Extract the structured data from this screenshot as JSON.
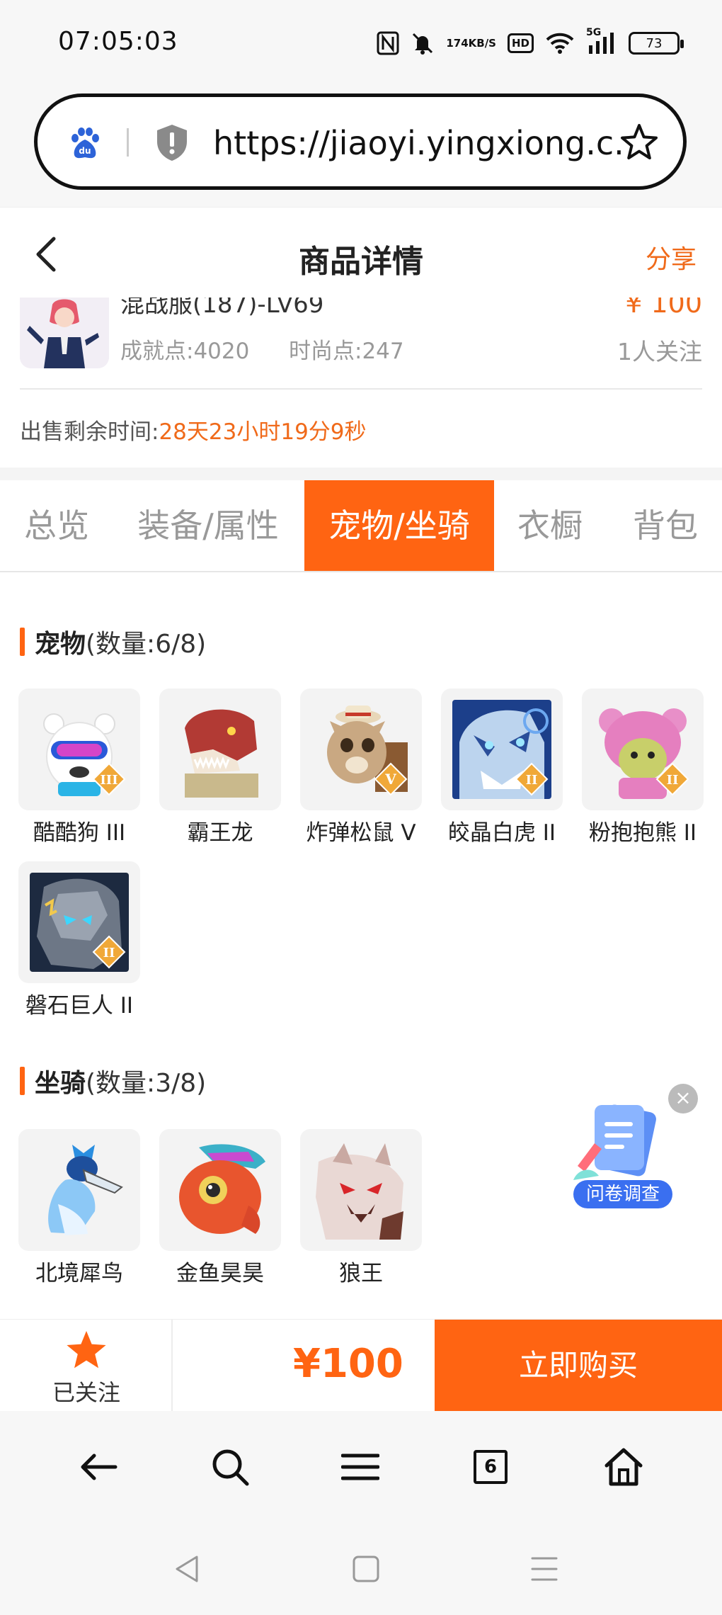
{
  "status_bar": {
    "time": "07:05:03",
    "speed_value": "174",
    "speed_unit": "KB/S",
    "hd_label": "HD",
    "network_label": "5G",
    "battery": "73"
  },
  "browser": {
    "url": "https://jiaoyi.yingxiong.c...",
    "tab_count": "6"
  },
  "header": {
    "title": "商品详情",
    "share_label": "分享"
  },
  "item": {
    "name": "混战服(187)-LV69",
    "price": "¥ 100",
    "achievement": "成就点:4020",
    "fashion": "时尚点:247",
    "followers": "1人关注",
    "remaining_label": "出售剩余时间:",
    "remaining_value": "28天23小时19分9秒"
  },
  "tabs": [
    {
      "label": "总览",
      "active": false
    },
    {
      "label": "装备/属性",
      "active": false
    },
    {
      "label": "宠物/坐骑",
      "active": true
    },
    {
      "label": "衣橱",
      "active": false
    },
    {
      "label": "背包",
      "active": false
    }
  ],
  "pets": {
    "title": "宠物",
    "count": "(数量:6/8)",
    "items": [
      {
        "label": "酷酷狗 III",
        "grade": "III"
      },
      {
        "label": "霸王龙",
        "grade": ""
      },
      {
        "label": "炸弹松鼠 V",
        "grade": "V"
      },
      {
        "label": "皎晶白虎 II",
        "grade": "II"
      },
      {
        "label": "粉抱抱熊 II",
        "grade": "II"
      },
      {
        "label": "磐石巨人 II",
        "grade": "II"
      }
    ]
  },
  "mounts": {
    "title": "坐骑",
    "count": "(数量:3/8)",
    "items": [
      {
        "label": "北境犀鸟"
      },
      {
        "label": "金鱼昊昊"
      },
      {
        "label": "狼王"
      }
    ]
  },
  "survey": {
    "label": "问卷调查"
  },
  "buy_bar": {
    "follow_label": "已关注",
    "price": "¥100",
    "buy_label": "立即购买"
  },
  "colors": {
    "accent": "#ff6412",
    "price_orange": "#f06a1a",
    "survey_blue": "#3a6ff0"
  }
}
